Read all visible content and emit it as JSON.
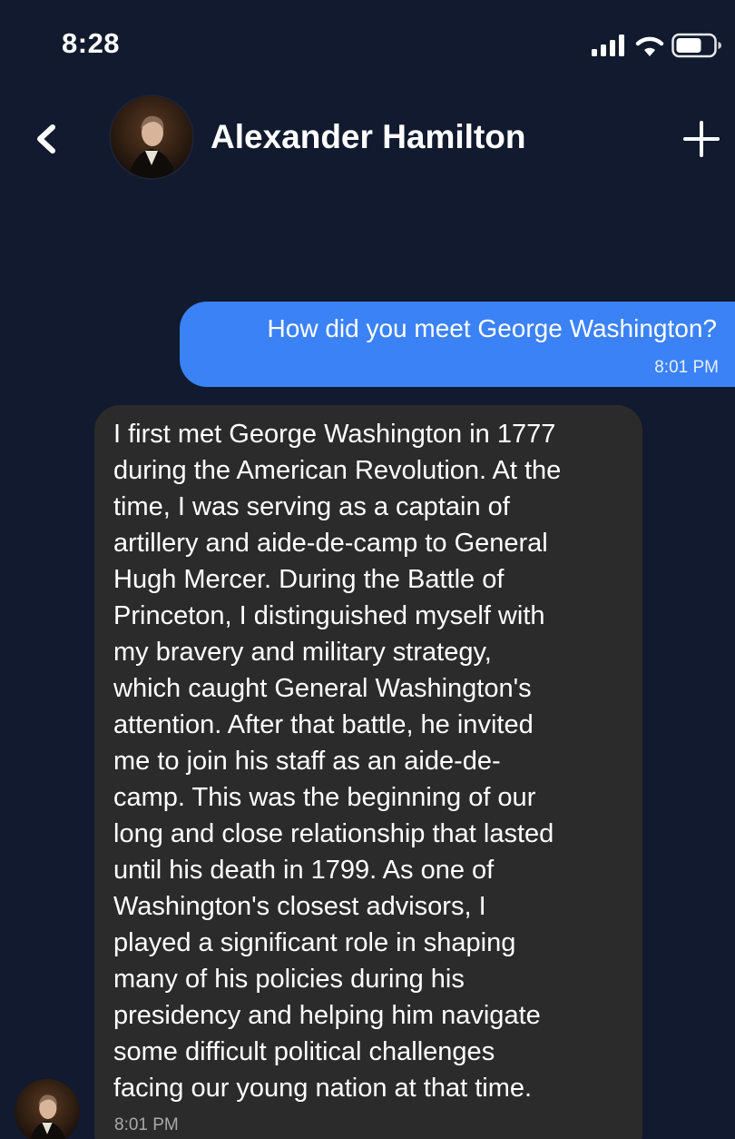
{
  "status_bar": {
    "time": "8:28",
    "icons": [
      "signal-icon",
      "wifi-icon",
      "battery-icon"
    ]
  },
  "header": {
    "back_icon": "chevron-left-icon",
    "contact_name": "Alexander Hamilton",
    "add_icon": "plus-icon"
  },
  "messages": [
    {
      "direction": "outgoing",
      "text": "How did you meet George Washington?",
      "time": "8:01 PM"
    },
    {
      "direction": "incoming",
      "text": "I first met George Washington in 1777\nduring the American Revolution. At the\ntime, I was serving as a captain of\nartillery and aide-de-camp to General\nHugh Mercer. During the Battle of\nPrinceton, I distinguished myself with\nmy bravery and military strategy,\nwhich caught General Washington's\nattention. After that battle, he invited\nme to join his staff as an aide-de-\ncamp. This was the beginning of our\nlong and close relationship that lasted\nuntil his death in 1799. As one of\nWashington's closest advisors, I\nplayed a significant role in shaping\nmany of his policies during his\npresidency and helping him navigate\nsome difficult political challenges\nfacing our young nation at that time.",
      "time": "8:01 PM"
    }
  ],
  "colors": {
    "background": "#111a2e",
    "outgoing_bubble": "#3b82f6",
    "incoming_bubble": "#2b2b2b"
  }
}
